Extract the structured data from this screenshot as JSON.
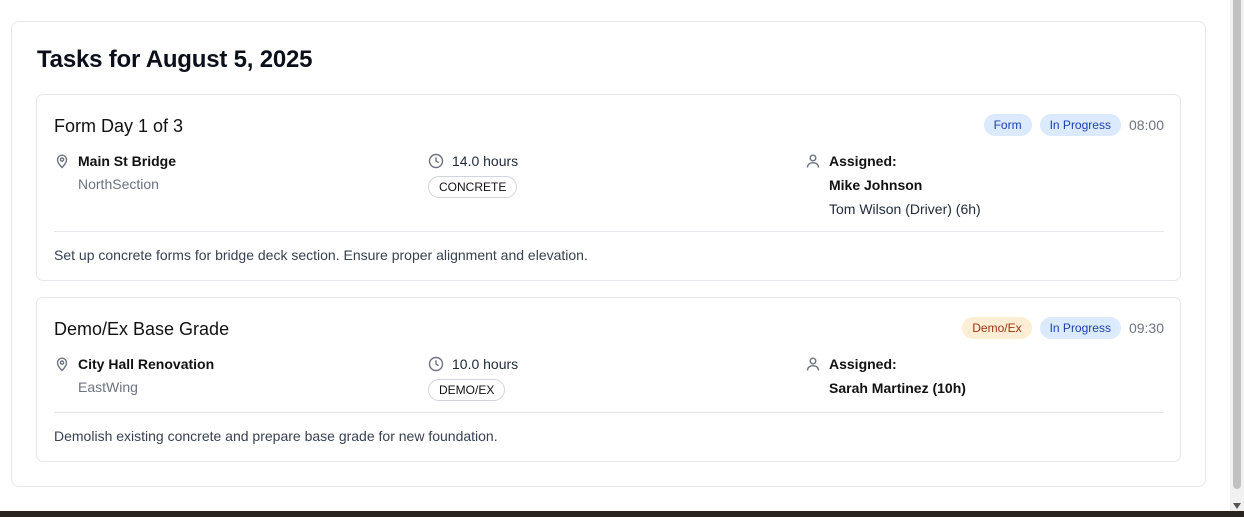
{
  "page": {
    "title": "Tasks for August 5, 2025"
  },
  "tasks": [
    {
      "title": "Form Day 1 of 3",
      "category_badge": "Form",
      "status_badge": "In Progress",
      "time": "08:00",
      "location": "Main St Bridge",
      "section": "NorthSection",
      "hours": "14.0 hours",
      "trade": "CONCRETE",
      "assigned_label": "Assigned:",
      "lead": "Mike Johnson",
      "crew": "Tom Wilson (Driver) (6h)",
      "description": "Set up concrete forms for bridge deck section. Ensure proper alignment and elevation."
    },
    {
      "title": "Demo/Ex Base Grade",
      "category_badge": "Demo/Ex",
      "status_badge": "In Progress",
      "time": "09:30",
      "location": "City Hall Renovation",
      "section": "EastWing",
      "hours": "10.0 hours",
      "trade": "DEMO/EX",
      "assigned_label": "Assigned:",
      "lead": "Sarah Martinez (10h)",
      "description": "Demolish existing concrete and prepare base grade for new foundation."
    }
  ],
  "icons": {
    "location": "map-pin-icon",
    "hours": "clock-icon",
    "assigned": "user-icon"
  },
  "colors": {
    "badge_blue_bg": "#dbeafe",
    "badge_blue_text": "#1e40af",
    "badge_orange_bg": "#ffedd5",
    "badge_orange_text": "#9a3412"
  }
}
